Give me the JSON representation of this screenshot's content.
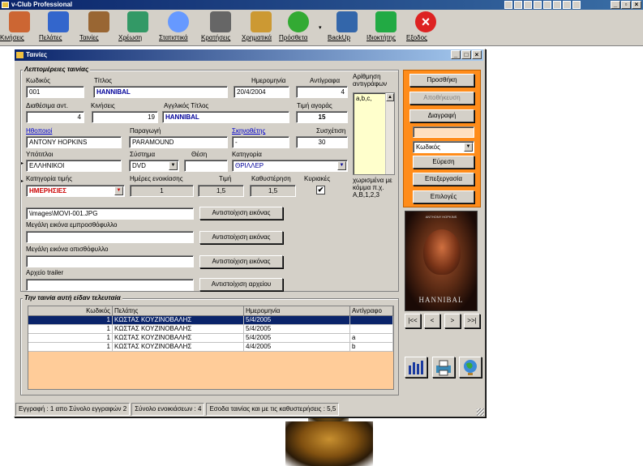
{
  "app": {
    "title": "v-Club Professional"
  },
  "toolbar": [
    {
      "label": "Κινήσεις",
      "icon": "film-reel-icon",
      "color": "#cc6633"
    },
    {
      "label": "Πελάτες",
      "icon": "users-icon",
      "color": "#3366cc"
    },
    {
      "label": "Ταινίες",
      "icon": "film-icon",
      "color": "#996633"
    },
    {
      "label": "Χρέωση",
      "icon": "calculator-icon",
      "color": "#339966"
    },
    {
      "label": "Στατιστικά",
      "icon": "pie-chart-icon",
      "color": "#6699ff"
    },
    {
      "label": "Κρατήσεις",
      "icon": "reservation-icon",
      "color": "#666666"
    },
    {
      "label": "Χρηματικά",
      "icon": "money-icon",
      "color": "#cc9933"
    },
    {
      "label": "Πρόσθετα",
      "icon": "globe-icon",
      "color": "#33aa33"
    },
    {
      "label": "BackUp",
      "icon": "backup-icon",
      "color": "#3366aa"
    },
    {
      "label": "Ιδιοκτήτης",
      "icon": "owner-icon",
      "color": "#22aa44"
    },
    {
      "label": "Εξοδος",
      "icon": "exit-icon",
      "color": "#dd2222"
    }
  ],
  "window": {
    "title": "Ταινίες"
  },
  "details": {
    "legend": "Λεπτομέρειες ταινίας",
    "code_label": "Κωδικός",
    "code": "001",
    "title_label": "Τίτλος",
    "title": "HANNIBAL",
    "date_label": "Ημερομηνία",
    "date": "20/4/2004",
    "copies_label": "Αντίγραφα",
    "copies": "4",
    "available_label": "Διαθέσιμα αντ.",
    "available": "4",
    "moves_label": "Κινήσεις",
    "moves": "19",
    "english_title_label": "Αγγλικός Τίτλος",
    "english_title": "HANNIBAL",
    "price_label": "Τιμή αγοράς",
    "price": "15",
    "actors_label": "Ηθοποιοί",
    "actors": "ANTONY HOPKINS",
    "production_label": "Παραγωγή",
    "production": "PARAMOUND",
    "director_label": "Σκηνοθέτης",
    "director": "-",
    "relation_label": "Συσχέτιση",
    "relation": "30",
    "subtitles_label": "Υπότιτλοι",
    "subtitles": "ΕΛΛΗΝΙΚΟΙ",
    "system_label": "Σύστημα",
    "system": "DVD",
    "position_label": "Θέση",
    "position": "",
    "category_label": "Κατηγορία",
    "category": "ΘΡΙΛΛΕΡ",
    "price_category_label": "Κατηγορία τιμής",
    "price_category": "ΗΜΕΡΗΣΙΕΣ",
    "rent_days_label": "Ημέρες ενοικίασης",
    "rent_days": "1",
    "rate_label": "Τιμή",
    "rate": "1,5",
    "delay_label": "Καθυστέρηση",
    "delay": "1,5",
    "sundays_label": "Κυριακές",
    "sundays_checked": "✔",
    "copy_numbering_label": "Αρίθμηση αντιγράφων",
    "copy_numbering": "a,b,c,",
    "copy_hint": "χωρισμένα με κόμμα π.χ. A,B,1,2,3",
    "front_image_value": "\\images\\MOVI-001.JPG",
    "big_front_label": "Μεγάλη εικόνα εμπροσθόφυλλο",
    "big_back_label": "Μεγάλη εικόνα οπισθόφυλλο",
    "trailer_label": "Αρχείο trailer",
    "match_image_btn": "Αντιστοίχιση εικόνας",
    "match_file_btn": "Αντιστοίχιση αρχείου"
  },
  "actions": {
    "add": "Προσθήκη",
    "save": "Αποθήκευση",
    "delete": "Διαγραφή",
    "search_field": "Κωδικός",
    "find": "Εύρεση",
    "edit": "Επεξεργασία",
    "options": "Επιλογές"
  },
  "poster": {
    "caption": "HANNIBAL",
    "top_text": "ANTHONY HOPKINS"
  },
  "nav": {
    "first": "|<<",
    "prev": "<",
    "next": ">",
    "last": ">>|"
  },
  "history": {
    "legend": "Την ταινία αυτή είδαν τελευταία",
    "columns": [
      "Κωδικός",
      "Πελάτης",
      "Ημερομηνία",
      "Αντίγραφο"
    ],
    "rows": [
      [
        "1",
        "ΚΩΣΤΑΣ ΚΟΥΖΙΝΟΒΑΛΗΣ",
        "5/4/2005",
        ""
      ],
      [
        "1",
        "ΚΩΣΤΑΣ ΚΟΥΖΙΝΟΒΑΛΗΣ",
        "5/4/2005",
        ""
      ],
      [
        "1",
        "ΚΩΣΤΑΣ ΚΟΥΖΙΝΟΒΑΛΗΣ",
        "5/4/2005",
        "a"
      ],
      [
        "1",
        "ΚΩΣΤΑΣ ΚΟΥΖΙΝΟΒΑΛΗΣ",
        "4/4/2005",
        "b"
      ]
    ]
  },
  "status": {
    "record": "Εγγραφή : 1 απο Σύνολο εγγραφών 2",
    "rentals": "Σύνολο ενοικιάσεων : 4",
    "income": "Εσοδα ταινίας και με τις καθυστερήσεις : 5,5"
  }
}
